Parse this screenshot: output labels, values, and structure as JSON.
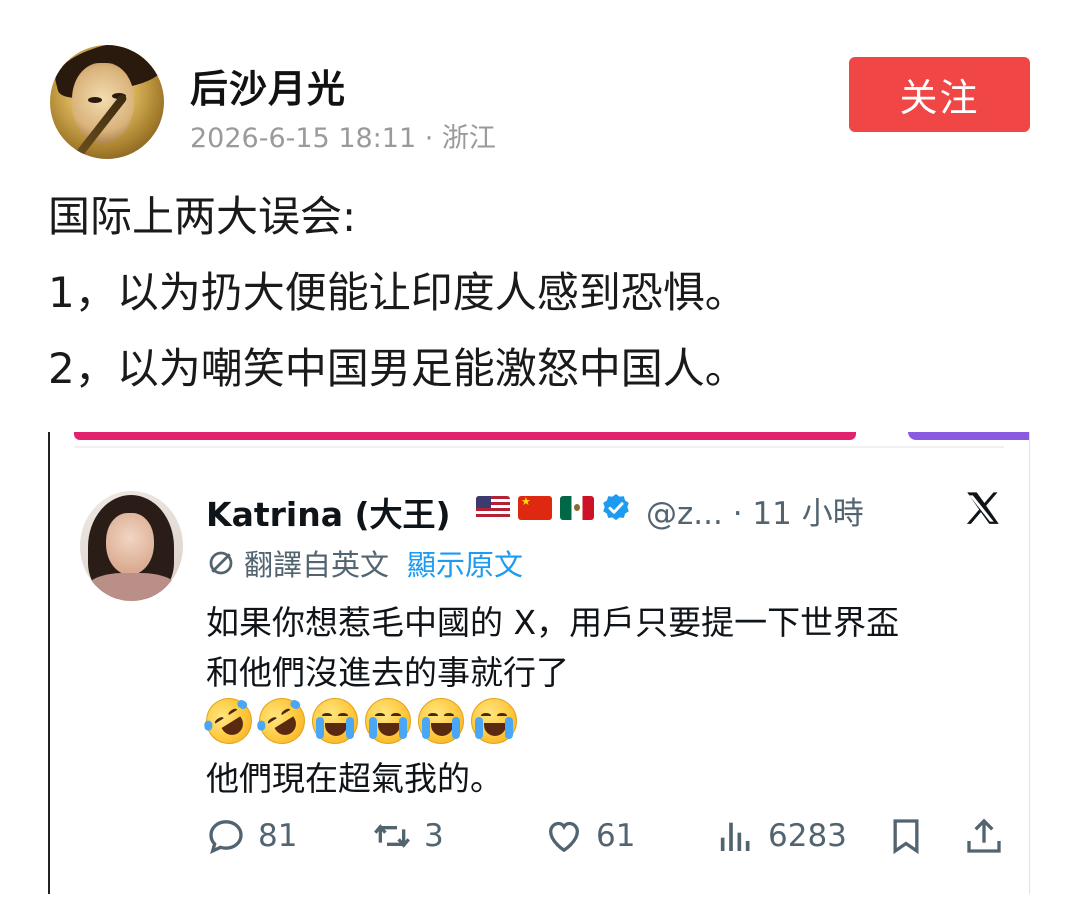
{
  "post": {
    "author": "后沙月光",
    "timestamp": "2026-6-15 18:11",
    "location": "浙江",
    "follow_label": "关注",
    "lines": [
      "国际上两大误会:",
      "1，以为扔大便能让印度人感到恐惧。",
      "2，以为嘲笑中国男足能激怒中国人。"
    ]
  },
  "embedded_tweet": {
    "name": "Katrina (大王)",
    "flags": [
      "us-flag",
      "china-flag",
      "mexico-flag"
    ],
    "handle": "@z...",
    "time": "· 11 小時",
    "translated_label": "翻譯自英文",
    "show_original_label": "顯示原文",
    "text_lines": [
      "如果你想惹毛中國的 X，用戶只要提一下世界盃",
      "和他們沒進去的事就行了",
      "他們現在超氣我的。"
    ],
    "emojis": [
      "rofl",
      "rofl",
      "sob",
      "sob",
      "sob",
      "sob"
    ],
    "actions": {
      "replies": "81",
      "retweets": "3",
      "likes": "61",
      "views": "6283"
    }
  },
  "colors": {
    "follow_button": "#f04646",
    "link_blue": "#1d9bf0",
    "meta_grey": "#9a9a9a",
    "tweet_grey": "#536471"
  }
}
